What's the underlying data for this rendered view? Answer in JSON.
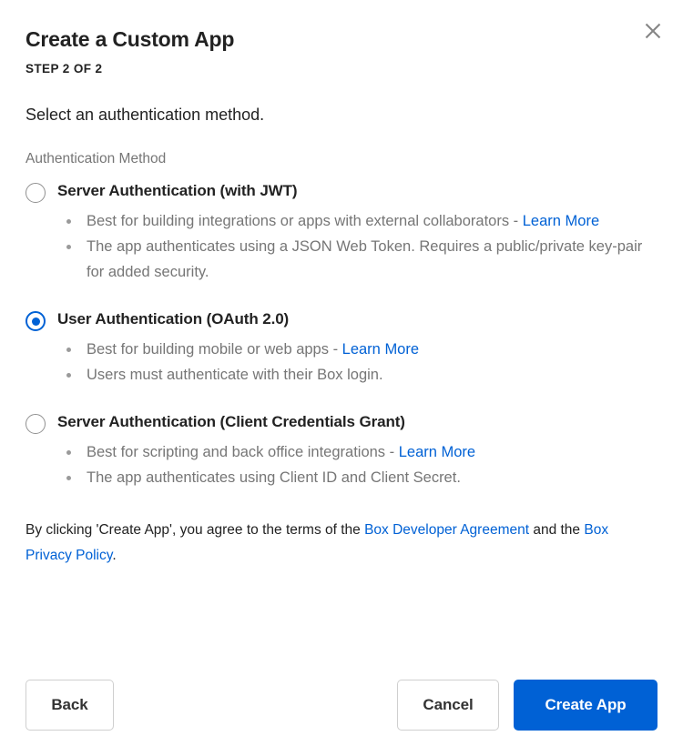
{
  "dialog": {
    "title": "Create a Custom App",
    "step_label": "STEP 2 OF 2",
    "close_label": "Close",
    "intro": "Select an authentication method.",
    "field_label": "Authentication Method"
  },
  "options": [
    {
      "id": "server-jwt",
      "title": "Server Authentication (with JWT)",
      "selected": false,
      "bullets": [
        {
          "text_before": "Best for building integrations or apps with external collaborators - ",
          "link_text": "Learn More",
          "text_after": ""
        },
        {
          "text_before": "The app authenticates using a JSON Web Token. Requires a public/private key-pair for added security.",
          "link_text": "",
          "text_after": ""
        }
      ]
    },
    {
      "id": "user-oauth2",
      "title": "User Authentication (OAuth 2.0)",
      "selected": true,
      "bullets": [
        {
          "text_before": "Best for building mobile or web apps - ",
          "link_text": "Learn More",
          "text_after": ""
        },
        {
          "text_before": "Users must authenticate with their Box login.",
          "link_text": "",
          "text_after": ""
        }
      ]
    },
    {
      "id": "server-ccg",
      "title": "Server Authentication (Client Credentials Grant)",
      "selected": false,
      "bullets": [
        {
          "text_before": "Best for scripting and back office integrations - ",
          "link_text": "Learn More",
          "text_after": ""
        },
        {
          "text_before": "The app authenticates using Client ID and Client Secret.",
          "link_text": "",
          "text_after": ""
        }
      ]
    }
  ],
  "legal": {
    "part1": "By clicking 'Create App', you agree to the terms of the ",
    "link1": "Box Developer Agreement",
    "part2": " and the ",
    "link2": "Box Privacy Policy",
    "part3": "."
  },
  "footer": {
    "back_label": "Back",
    "cancel_label": "Cancel",
    "create_label": "Create App"
  },
  "colors": {
    "accent": "#0061d5",
    "link": "#0061d5",
    "muted_text": "#767676",
    "primary_text": "#222222",
    "border": "#cfcfcf",
    "radio_unselected": "#909090"
  }
}
